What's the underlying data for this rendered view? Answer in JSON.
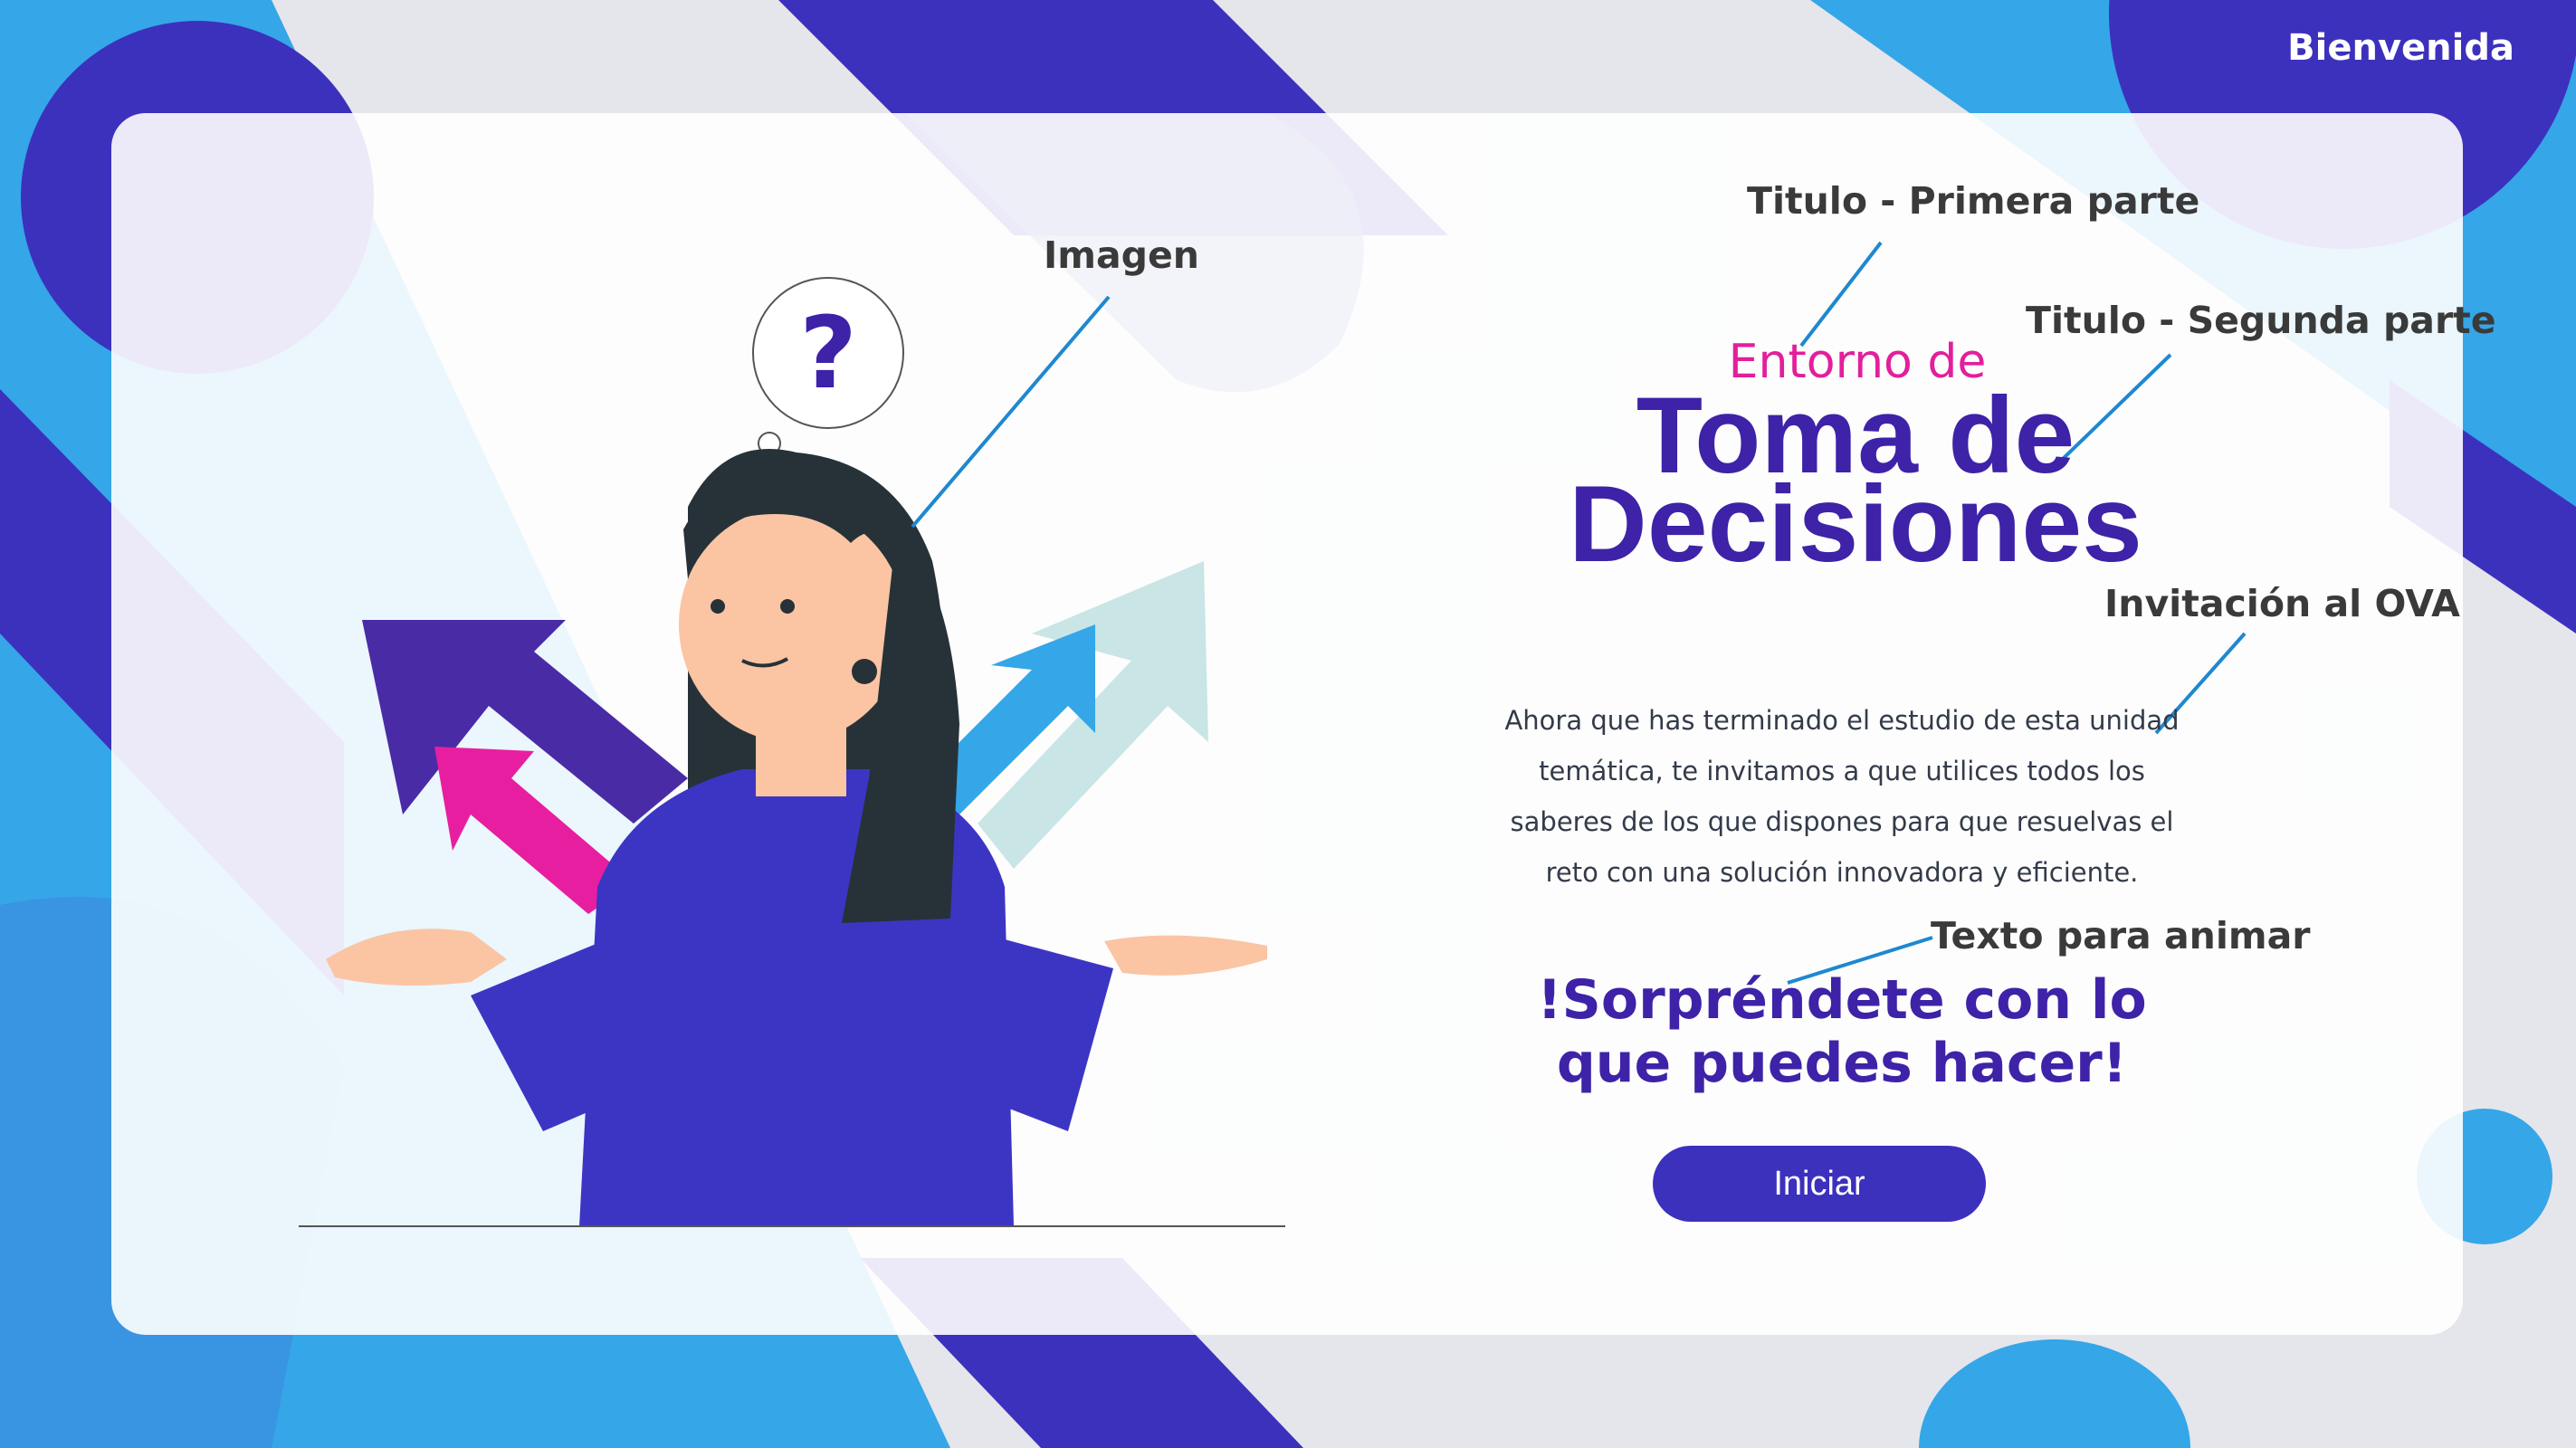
{
  "header": {
    "welcome_label": "Bienvenida"
  },
  "annotations": {
    "imagen": "Imagen",
    "titulo_primera": "Titulo - Primera parte",
    "titulo_segunda": "Titulo - Segunda parte",
    "invitacion": "Invitación al OVA",
    "texto_animar": "Texto para animar"
  },
  "illustration": {
    "question_mark": "?"
  },
  "title": {
    "part1": "Entorno de",
    "part2": "Toma de Decisiones"
  },
  "intro_text": "Ahora que has terminado el estudio de esta unidad temática, te invitamos a que utilices todos los saberes de los que dispones para que resuelvas el reto con una solución innovadora y eficiente.",
  "cheer_text": "!Sorpréndete con lo que puedes hacer!",
  "start_button": {
    "label": "Iniciar"
  },
  "colors": {
    "primary": "#3c31bd",
    "accent_pink": "#e21f9c",
    "light_blue": "#35a6e8",
    "title_purple": "#3e22a8",
    "connector": "#1e88d0"
  }
}
